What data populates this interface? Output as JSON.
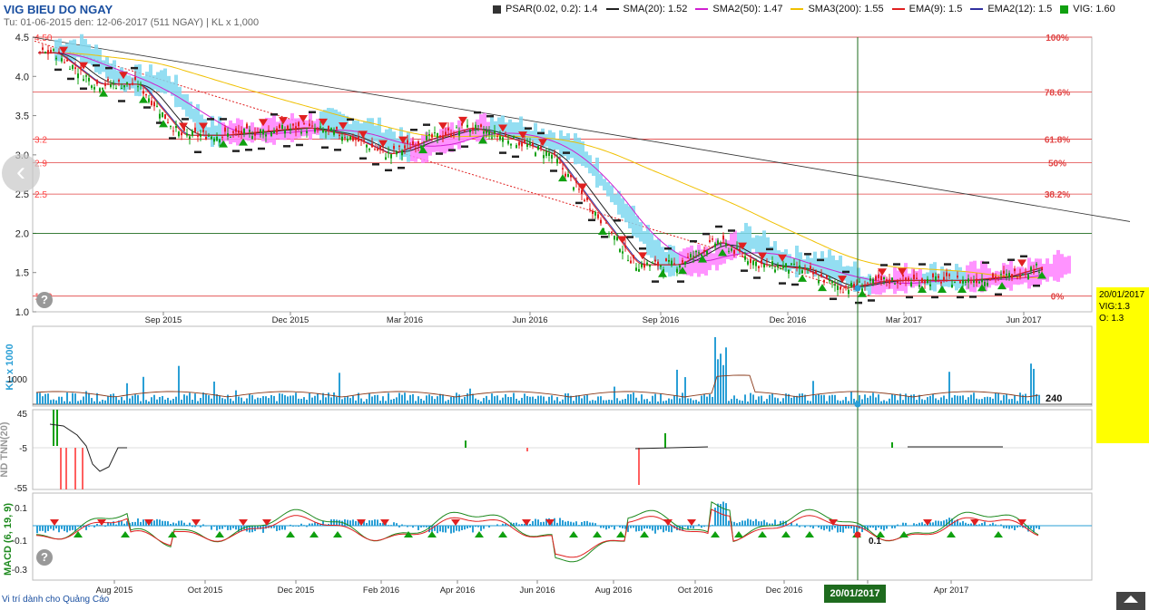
{
  "header": {
    "title": "VIG BIEU DO NGAY",
    "subtitle": "Tu: 01-06-2015 den: 12-06-2017 (511 NGAY) | KL x 1,000"
  },
  "legend": [
    {
      "label": "PSAR(0.02, 0.2): 1.4",
      "color": "#333333",
      "kind": "square"
    },
    {
      "label": "SMA(20): 1.52",
      "color": "#222222",
      "kind": "line"
    },
    {
      "label": "SMA2(50): 1.47",
      "color": "#d020d0",
      "kind": "line"
    },
    {
      "label": "SMA3(200): 1.55",
      "color": "#f0c000",
      "kind": "line"
    },
    {
      "label": "EMA(9): 1.5",
      "color": "#e02020",
      "kind": "line"
    },
    {
      "label": "EMA2(12): 1.5",
      "color": "#3030a0",
      "kind": "line"
    },
    {
      "label": "VIG: 1.60",
      "color": "#10a010",
      "kind": "square"
    }
  ],
  "colors": {
    "up": "#10a010",
    "down": "#e02020",
    "fib": "#e04040",
    "volume": "#2a9fd6",
    "cloud_up": "#ff80ff",
    "cloud_down": "#80d8f0",
    "crosshair": "#1e6b1e"
  },
  "icons": {
    "nav_prev": "chevron-left-icon",
    "help": "question-icon",
    "scroll_up": "arrow-up-icon"
  },
  "tooltip": {
    "date": "20/01/2017",
    "symbol": "VIG:1.3",
    "open": "O: 1.3"
  },
  "ad_note": "Vi trí dành cho Quảng Cáo",
  "crosshair_date": "20/01/2017",
  "chart_data": [
    {
      "type": "candlestick",
      "title": "VIG BIEU DO NGAY",
      "ylim": [
        1.0,
        4.5
      ],
      "yticks": [
        "1.0",
        "1.5",
        "2.0",
        "2.5",
        "3.0",
        "3.5",
        "4.0",
        "4.5"
      ],
      "xticks": [
        "Sep 2015",
        "Dec 2015",
        "Mar 2016",
        "Jun 2016",
        "Sep 2016",
        "Dec 2016",
        "Mar 2017",
        "Jun 2017"
      ],
      "price_series": [
        {
          "date": "2015-06",
          "value": 4.3
        },
        {
          "date": "2015-07",
          "value": 3.9
        },
        {
          "date": "2015-08",
          "value": 3.9
        },
        {
          "date": "2015-09",
          "value": 3.25
        },
        {
          "date": "2015-10",
          "value": 3.25
        },
        {
          "date": "2015-11",
          "value": 3.3
        },
        {
          "date": "2015-12",
          "value": 3.35
        },
        {
          "date": "2016-01",
          "value": 3.25
        },
        {
          "date": "2016-02",
          "value": 3.0
        },
        {
          "date": "2016-03",
          "value": 3.2
        },
        {
          "date": "2016-04",
          "value": 3.35
        },
        {
          "date": "2016-05",
          "value": 3.2
        },
        {
          "date": "2016-06",
          "value": 3.0
        },
        {
          "date": "2016-07",
          "value": 2.3
        },
        {
          "date": "2016-08",
          "value": 1.6
        },
        {
          "date": "2016-09",
          "value": 1.6
        },
        {
          "date": "2016-10",
          "value": 1.9
        },
        {
          "date": "2016-11",
          "value": 1.6
        },
        {
          "date": "2016-12",
          "value": 1.55
        },
        {
          "date": "2017-01",
          "value": 1.3
        },
        {
          "date": "2017-02",
          "value": 1.4
        },
        {
          "date": "2017-03",
          "value": 1.4
        },
        {
          "date": "2017-04",
          "value": 1.4
        },
        {
          "date": "2017-05",
          "value": 1.45
        },
        {
          "date": "2017-06",
          "value": 1.6
        }
      ],
      "fibonacci": [
        {
          "label": "100%",
          "value": 4.5
        },
        {
          "label": "78.6%",
          "value": 3.8
        },
        {
          "label": "61.8%",
          "value": 3.2
        },
        {
          "label": "50%",
          "value": 2.9
        },
        {
          "label": "38.2%",
          "value": 2.5
        },
        {
          "label": "0%",
          "value": 1.2
        }
      ],
      "left_labels": [
        "4.50",
        "3.2",
        "2.9",
        "2.5",
        "1.20"
      ],
      "reference_line": 2.0
    },
    {
      "type": "bar",
      "ylabel": "KL x 1000",
      "yticks": [
        "1000"
      ],
      "last_value_label": "240"
    },
    {
      "type": "bar",
      "ylabel": "ND TNN(20)",
      "yticks": [
        "45",
        "-5",
        "-55"
      ]
    },
    {
      "type": "bar",
      "ylabel": "MACD (6, 19, 9)",
      "yticks": [
        "0.1",
        "-0.1",
        "-0.3"
      ],
      "marker_label": "0.1",
      "xticks": [
        "Aug 2015",
        "Oct 2015",
        "Dec 2015",
        "Feb 2016",
        "Apr 2016",
        "Jun 2016",
        "Aug 2016",
        "Oct 2016",
        "Dec 2016",
        "Feb 2017",
        "Apr 2017"
      ]
    }
  ]
}
